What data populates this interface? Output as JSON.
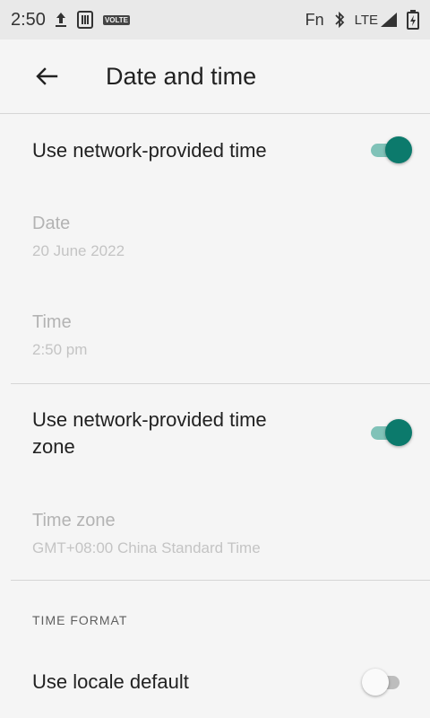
{
  "status_bar": {
    "time": "2:50",
    "fn_label": "Fn",
    "network_label": "LTE",
    "volte_label": "VOLTE"
  },
  "app_bar": {
    "title": "Date and time"
  },
  "settings": {
    "network_time": {
      "label": "Use network-provided time",
      "enabled": true
    },
    "date": {
      "label": "Date",
      "value": "20 June 2022"
    },
    "time": {
      "label": "Time",
      "value": "2:50 pm"
    },
    "network_time_zone": {
      "label_line1": "Use network-provided time",
      "label_line2": "zone",
      "enabled": true
    },
    "time_zone": {
      "label": "Time zone",
      "value": "GMT+08:00 China Standard Time"
    },
    "time_format_header": "TIME FORMAT",
    "locale_default": {
      "label": "Use locale default",
      "enabled": false
    }
  },
  "colors": {
    "accent": "#0c7a6c",
    "accent_track": "#80c2b8",
    "background": "#f5f5f5",
    "disabled_text": "#b3b3b3"
  }
}
